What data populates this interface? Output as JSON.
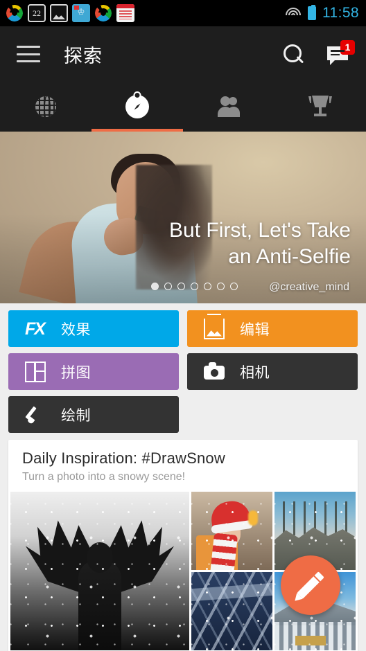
{
  "statusbar": {
    "time": "11:58",
    "app_icons": [
      {
        "name": "pinwheel-app-icon"
      },
      {
        "name": "calendar-app-icon",
        "label": "22"
      },
      {
        "name": "gallery-app-icon"
      },
      {
        "name": "book-app-icon"
      },
      {
        "name": "pinwheel-app-icon-2"
      },
      {
        "name": "notes-app-icon"
      }
    ],
    "wifi_icon": "wifi-icon",
    "battery_icon": "battery-icon",
    "time_color": "#33b5e5"
  },
  "toolbar": {
    "menu_icon": "hamburger-menu-icon",
    "title": "探索",
    "search_icon": "search-icon",
    "messages_icon": "messages-icon",
    "messages_badge": "1",
    "badge_color": "#e60000",
    "background": "#1e1e1e"
  },
  "tabs": {
    "accent": "#ef6c45",
    "items": [
      {
        "name": "tab-world",
        "icon": "globe-icon",
        "active": false
      },
      {
        "name": "tab-explore",
        "icon": "compass-icon",
        "active": true
      },
      {
        "name": "tab-people",
        "icon": "people-icon",
        "active": false
      },
      {
        "name": "tab-contests",
        "icon": "trophy-icon",
        "active": false
      }
    ]
  },
  "hero": {
    "title": "But First, Let's Take\nan Anti-Selfie",
    "username": "@creative_mind",
    "dots_total": 7,
    "dots_active_index": 0
  },
  "actions": [
    {
      "name": "effects-button",
      "label": "效果",
      "icon": "fx-icon",
      "color": "#00a8e8"
    },
    {
      "name": "edit-button",
      "label": "编辑",
      "icon": "image-edit-icon",
      "color": "#f2911f"
    },
    {
      "name": "collage-button",
      "label": "拼图",
      "icon": "collage-icon",
      "color": "#9a6cb4"
    },
    {
      "name": "camera-button",
      "label": "相机",
      "icon": "camera-icon",
      "color": "#333333"
    },
    {
      "name": "draw-button",
      "label": "绘制",
      "icon": "brush-icon",
      "color": "#333333"
    }
  ],
  "card": {
    "title": "Daily Inspiration: #DrawSnow",
    "subtitle": "Turn a photo into a snowy scene!",
    "photos": [
      {
        "name": "photo-angel-in-snow"
      },
      {
        "name": "photo-santa-hat-crowd"
      },
      {
        "name": "photo-snowy-forest"
      },
      {
        "name": "photo-snowy-town-rooftops"
      },
      {
        "name": "photo-snowy-valley"
      }
    ]
  },
  "fab": {
    "name": "compose-fab",
    "icon": "pencil-icon",
    "color": "#ef6c45"
  }
}
